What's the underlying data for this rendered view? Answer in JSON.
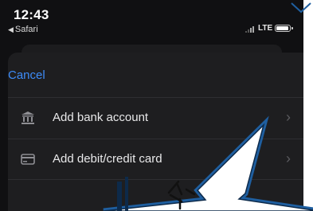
{
  "status_bar": {
    "time": "12:43",
    "back_app": "Safari",
    "network": "LTE"
  },
  "sheet": {
    "cancel_label": "Cancel",
    "rows": [
      {
        "label": "Add bank account",
        "icon": "bank-icon"
      },
      {
        "label": "Add debit/credit card",
        "icon": "card-icon"
      }
    ]
  },
  "overlay": {
    "arrow_color": "#1f5fa0",
    "arrow_fill": "#ffffff"
  },
  "colors": {
    "background": "#101012",
    "sheet": "#1e1e20",
    "accent": "#3d8bf7",
    "text": "#e9e9ea"
  }
}
